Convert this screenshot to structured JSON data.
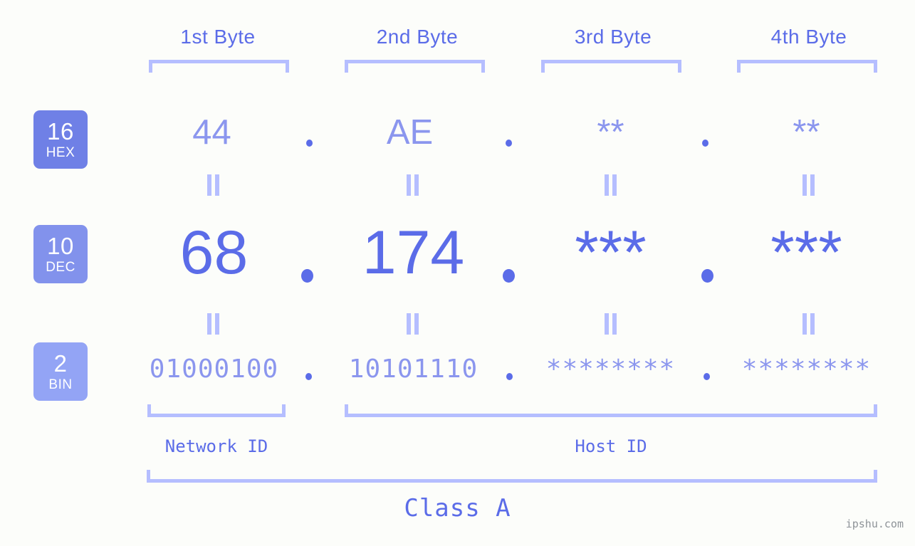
{
  "background_color": "#fcfdfa",
  "accent_colors": {
    "strong_blue": "#5b6ce8",
    "light_blue": "#8b96ee",
    "bracket_blue": "#b5beff",
    "badge_hex": "#6f80e6",
    "badge_dec": "#8292ec",
    "badge_bin": "#93a4f5",
    "watermark_gray": "#8e9398"
  },
  "byte_headers": [
    {
      "label": "1st Byte"
    },
    {
      "label": "2nd Byte"
    },
    {
      "label": "3rd Byte"
    },
    {
      "label": "4th Byte"
    }
  ],
  "rows": [
    {
      "key": "hex",
      "badge_number": "16",
      "badge_abbr": "HEX",
      "values": [
        "44",
        "AE",
        "**",
        "**"
      ],
      "separator": "."
    },
    {
      "key": "dec",
      "badge_number": "10",
      "badge_abbr": "DEC",
      "values": [
        "68",
        "174",
        "***",
        "***"
      ],
      "separator": "."
    },
    {
      "key": "bin",
      "badge_number": "2",
      "badge_abbr": "BIN",
      "values": [
        "01000100",
        "10101110",
        "********",
        "********"
      ],
      "separator": "."
    }
  ],
  "equality_symbol": "=",
  "sections": {
    "network_id": "Network ID",
    "host_id": "Host ID",
    "class": "Class A"
  },
  "watermark": "ipshu.com"
}
